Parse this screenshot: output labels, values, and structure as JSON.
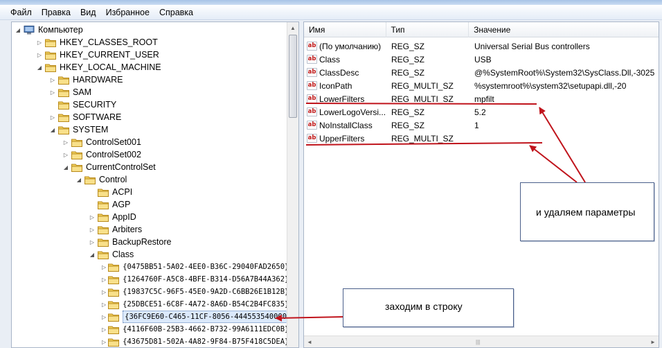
{
  "menubar": {
    "items": [
      "Файл",
      "Правка",
      "Вид",
      "Избранное",
      "Справка"
    ]
  },
  "tree": {
    "nodes": [
      {
        "label": "Компьютер",
        "depth": 0,
        "expanded": true,
        "icon": "computer-icon"
      },
      {
        "label": "HKEY_CLASSES_ROOT",
        "depth": 1,
        "expanded": false
      },
      {
        "label": "HKEY_CURRENT_USER",
        "depth": 1,
        "expanded": false
      },
      {
        "label": "HKEY_LOCAL_MACHINE",
        "depth": 1,
        "expanded": true
      },
      {
        "label": "HARDWARE",
        "depth": 2,
        "expanded": false
      },
      {
        "label": "SAM",
        "depth": 2,
        "expanded": false
      },
      {
        "label": "SECURITY",
        "depth": 2,
        "expanded": false,
        "leaf": true
      },
      {
        "label": "SOFTWARE",
        "depth": 2,
        "expanded": false
      },
      {
        "label": "SYSTEM",
        "depth": 2,
        "expanded": true
      },
      {
        "label": "ControlSet001",
        "depth": 3,
        "expanded": false
      },
      {
        "label": "ControlSet002",
        "depth": 3,
        "expanded": false
      },
      {
        "label": "CurrentControlSet",
        "depth": 3,
        "expanded": true
      },
      {
        "label": "Control",
        "depth": 4,
        "expanded": true
      },
      {
        "label": "ACPI",
        "depth": 5,
        "expanded": false,
        "leaf": true
      },
      {
        "label": "AGP",
        "depth": 5,
        "expanded": false,
        "leaf": true
      },
      {
        "label": "AppID",
        "depth": 5,
        "expanded": false
      },
      {
        "label": "Arbiters",
        "depth": 5,
        "expanded": false
      },
      {
        "label": "BackupRestore",
        "depth": 5,
        "expanded": false
      },
      {
        "label": "Class",
        "depth": 5,
        "expanded": true
      },
      {
        "label": "{0475BB51-5A02-4EE0-B36C-29040FAD2650}",
        "depth": 6,
        "expanded": false,
        "mono": true
      },
      {
        "label": "{1264760F-A5C8-4BFE-B314-D56A7B44A362}",
        "depth": 6,
        "expanded": false,
        "mono": true
      },
      {
        "label": "{19837C5C-96F5-45E0-9A2D-C6BB26E1B12B}",
        "depth": 6,
        "expanded": false,
        "mono": true
      },
      {
        "label": "{25DBCE51-6C8F-4A72-8A6D-B54C2B4FC835}",
        "depth": 6,
        "expanded": false,
        "mono": true
      },
      {
        "label": "{36FC9E60-C465-11CF-8056-444553540000}",
        "depth": 6,
        "expanded": false,
        "mono": true,
        "selected": true
      },
      {
        "label": "{4116F60B-25B3-4662-B732-99A6111EDC0B}",
        "depth": 6,
        "expanded": false,
        "mono": true
      },
      {
        "label": "{43675D81-502A-4A82-9F84-B75F418C5DEA}",
        "depth": 6,
        "expanded": false,
        "mono": true
      }
    ]
  },
  "list": {
    "headers": {
      "name": "Имя",
      "type": "Тип",
      "value": "Значение"
    },
    "rows": [
      {
        "name": "(По умолчанию)",
        "type": "REG_SZ",
        "value": "Universal Serial Bus controllers"
      },
      {
        "name": "Class",
        "type": "REG_SZ",
        "value": "USB"
      },
      {
        "name": "ClassDesc",
        "type": "REG_SZ",
        "value": "@%SystemRoot%\\System32\\SysClass.Dll,-3025"
      },
      {
        "name": "IconPath",
        "type": "REG_MULTI_SZ",
        "value": "%systemroot%\\system32\\setupapi.dll,-20"
      },
      {
        "name": "LowerFilters",
        "type": "REG_MULTI_SZ",
        "value": "mpfilt"
      },
      {
        "name": "LowerLogoVersi...",
        "type": "REG_SZ",
        "value": "5.2"
      },
      {
        "name": "NoInstallClass",
        "type": "REG_SZ",
        "value": "1"
      },
      {
        "name": "UpperFilters",
        "type": "REG_MULTI_SZ",
        "value": ""
      }
    ]
  },
  "annotations": {
    "remove_params": "и удаляем параметры",
    "enter_row": "заходим в строку",
    "arrow_color": "#c0141c"
  },
  "icons": {
    "value_icon_text": "ab"
  }
}
